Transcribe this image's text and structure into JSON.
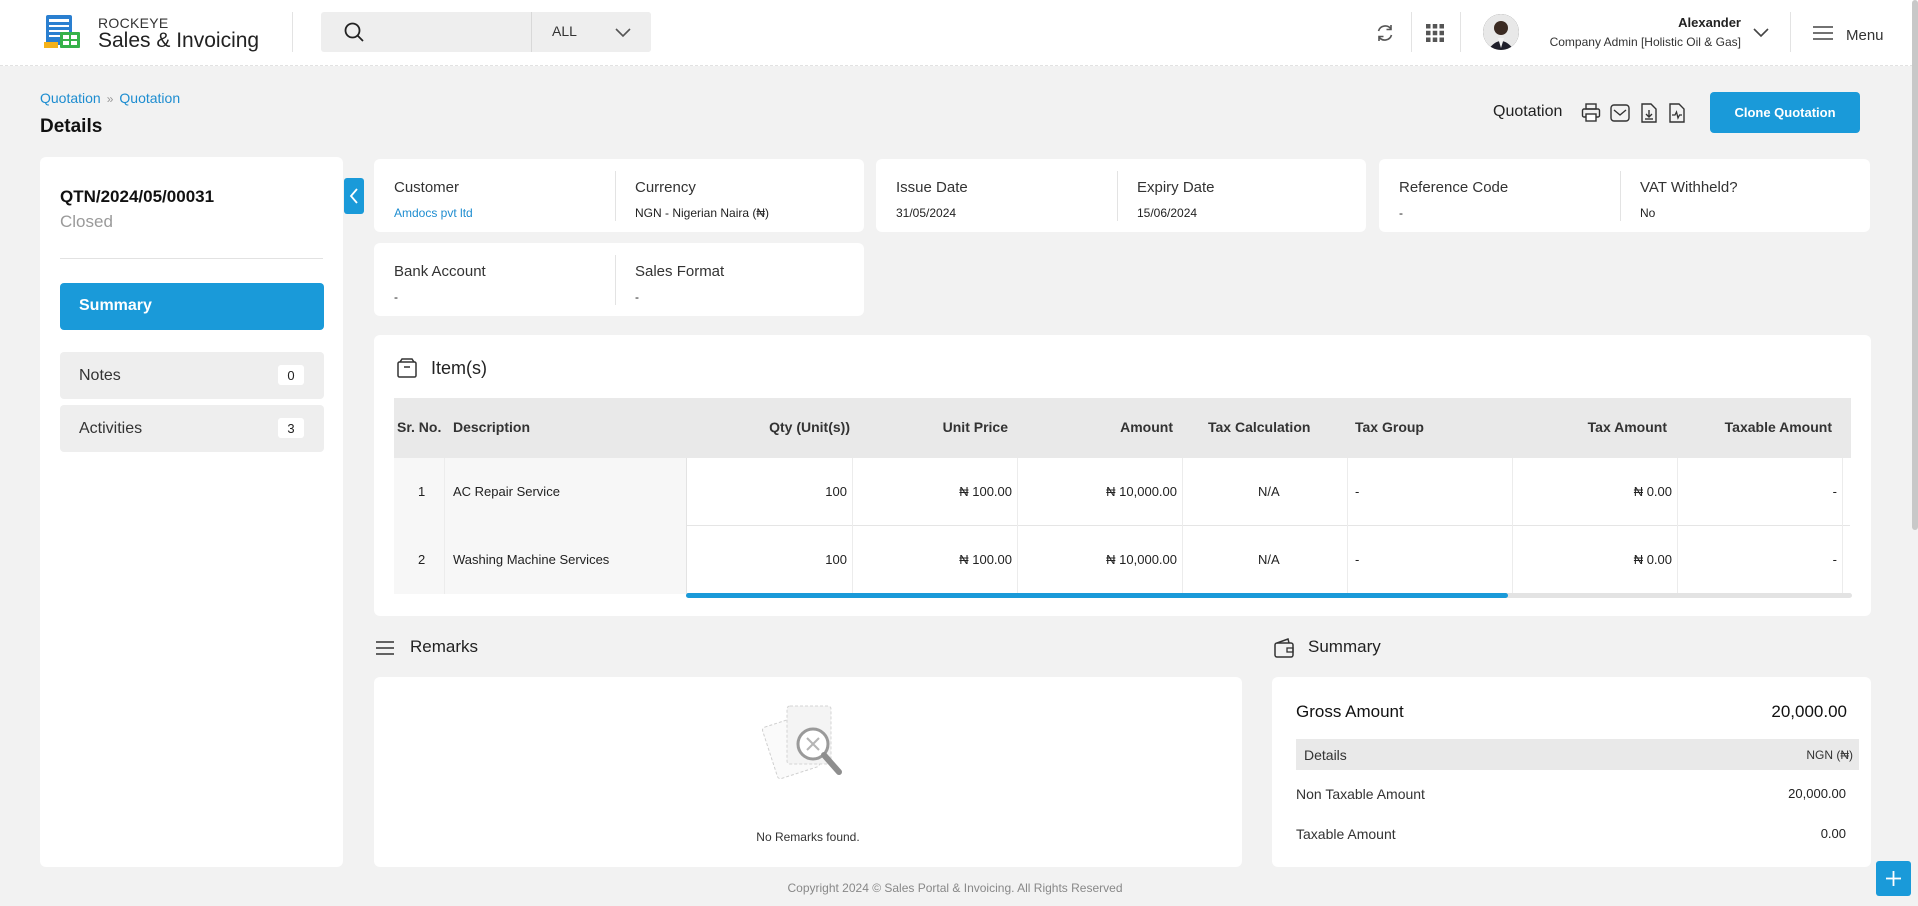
{
  "app": {
    "brand_small": "ROCKEYE",
    "brand_name": "Sales & Invoicing"
  },
  "header": {
    "search_placeholder": "",
    "filter_value": "ALL",
    "user_name": "Alexander",
    "user_role": "Company Admin [Holistic Oil & Gas]",
    "menu_label": "Menu"
  },
  "breadcrumb": {
    "item1": "Quotation",
    "item2": "Quotation"
  },
  "page": {
    "title": "Details",
    "doc_type_label": "Quotation",
    "clone_button": "Clone Quotation"
  },
  "left_panel": {
    "doc_number": "QTN/2024/05/00031",
    "status": "Closed",
    "nav": {
      "summary": "Summary",
      "notes": {
        "label": "Notes",
        "count": "0"
      },
      "activities": {
        "label": "Activities",
        "count": "3"
      }
    }
  },
  "info": {
    "customer": {
      "label": "Customer",
      "value": "Amdocs pvt ltd"
    },
    "currency": {
      "label": "Currency",
      "value": "NGN - Nigerian Naira (₦)"
    },
    "issue_date": {
      "label": "Issue Date",
      "value": "31/05/2024"
    },
    "expiry_date": {
      "label": "Expiry Date",
      "value": "15/06/2024"
    },
    "reference_code": {
      "label": "Reference Code",
      "value": "-"
    },
    "vat_withheld": {
      "label": "VAT Withheld?",
      "value": "No"
    },
    "bank_account": {
      "label": "Bank Account",
      "value": "-"
    },
    "sales_format": {
      "label": "Sales Format",
      "value": "-"
    }
  },
  "items": {
    "title": "Item(s)",
    "columns": {
      "sr": "Sr. No.",
      "description": "Description",
      "qty": "Qty (Unit(s))",
      "unit_price": "Unit Price",
      "amount": "Amount",
      "tax_calc": "Tax Calculation",
      "tax_group": "Tax Group",
      "tax_amount": "Tax Amount",
      "taxable_amount": "Taxable Amount"
    },
    "rows": [
      {
        "sr": "1",
        "description": "AC Repair Service",
        "qty": "100",
        "unit_price": "₦ 100.00",
        "amount": "₦ 10,000.00",
        "tax_calc": "N/A",
        "tax_group": "-",
        "tax_amount": "₦ 0.00",
        "taxable_amount": "-"
      },
      {
        "sr": "2",
        "description": "Washing Machine Services",
        "qty": "100",
        "unit_price": "₦ 100.00",
        "amount": "₦ 10,000.00",
        "tax_calc": "N/A",
        "tax_group": "-",
        "tax_amount": "₦ 0.00",
        "taxable_amount": "-"
      }
    ]
  },
  "remarks": {
    "title": "Remarks",
    "empty_text": "No Remarks found."
  },
  "summary": {
    "title": "Summary",
    "gross_label": "Gross Amount",
    "gross_value": "20,000.00",
    "details_label": "Details",
    "details_currency": "NGN (₦)",
    "non_taxable_label": "Non Taxable Amount",
    "non_taxable_value": "20,000.00",
    "taxable_label": "Taxable Amount",
    "taxable_value": "0.00"
  },
  "footer": {
    "text": "Copyright 2024 © Sales Portal & Invoicing. All Rights Reserved"
  },
  "colors": {
    "accent": "#1a9ad9",
    "link": "#1e8dd0",
    "background": "#f2f2f2"
  },
  "icons": [
    "app-logo-icon",
    "search-icon",
    "chevron-down-icon",
    "refresh-icon",
    "apps-grid-icon",
    "hamburger-icon",
    "print-icon",
    "email-icon",
    "download-icon",
    "pdf-icon",
    "chevron-left-icon",
    "box-icon",
    "list-icon",
    "wallet-icon",
    "empty-search-icon",
    "plus-icon"
  ]
}
